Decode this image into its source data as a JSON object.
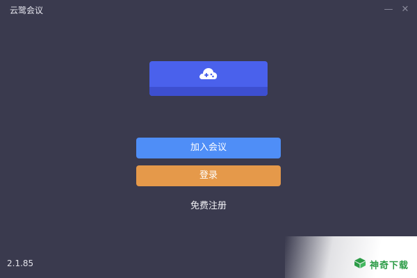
{
  "window": {
    "title": "云鹭会议",
    "minimize_glyph": "—",
    "close_glyph": "✕"
  },
  "logo": {
    "icon": "cloud-gamepad-icon",
    "colors": {
      "top": "#4a61ec",
      "bottom": "#3d4fd0"
    }
  },
  "actions": {
    "join_label": "加入会议",
    "login_label": "登录",
    "register_label": "免费注册"
  },
  "colors": {
    "background": "#3a3a4e",
    "join_button": "#4f8ef7",
    "login_button": "#e5994a"
  },
  "footer": {
    "version": "2.1.85"
  },
  "watermark": {
    "text": "神奇下载",
    "icon": "green-box-icon",
    "color": "#2c9c47"
  }
}
